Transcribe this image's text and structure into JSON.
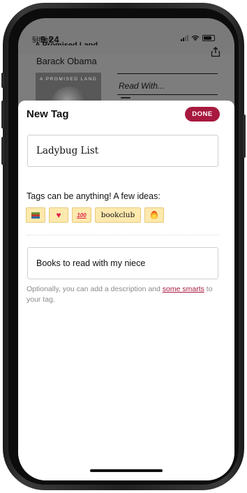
{
  "status_bar": {
    "time": "9:24"
  },
  "shelf": {
    "label": "SHELF",
    "book_title": "A Promised Land",
    "author": "Barack Obama",
    "cover_text": "A PROMISED LAND",
    "current_tag": "Read With..."
  },
  "sheet": {
    "title": "New Tag",
    "done_label": "DONE",
    "tag_name_value": "Ladybug List",
    "ideas_label": "Tags can be anything! A few ideas:",
    "idea_chips": [
      {
        "icon": "books-emoji"
      },
      {
        "icon": "heart-emoji"
      },
      {
        "icon": "hundred-emoji"
      },
      {
        "text": "bookclub"
      },
      {
        "icon": "fire-emoji"
      }
    ],
    "description_value": "Books to read with my niece",
    "help_text_before": "Optionally, you can add a description and ",
    "help_link": "some smarts",
    "help_text_after": " to your tag."
  },
  "colors": {
    "accent": "#a8193f",
    "chip_bg": "#fde9ae",
    "chip_border": "#e8c97a"
  }
}
